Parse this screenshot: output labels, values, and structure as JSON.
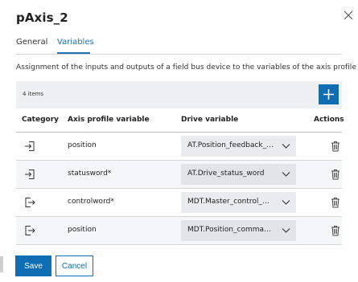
{
  "dialog": {
    "title": "pAxis_2",
    "close_icon": "close-icon"
  },
  "tabs": [
    {
      "label": "General",
      "active": false
    },
    {
      "label": "Variables",
      "active": true
    }
  ],
  "description": "Assignment of the inputs and outputs of a field bus device to the variables of the axis profile",
  "toolbar": {
    "item_count": "4 items",
    "add_icon": "plus-icon"
  },
  "table": {
    "headers": {
      "category": "Category",
      "axis_profile_variable": "Axis profile variable",
      "drive_variable": "Drive variable",
      "actions": "Actions"
    },
    "rows": [
      {
        "category_icon": "input-icon",
        "variable": "position",
        "drive_variable": "AT.Position_feedback_value",
        "action_icon": "trash-icon"
      },
      {
        "category_icon": "input-icon",
        "variable": "statusword*",
        "drive_variable": "AT.Drive_status_word",
        "action_icon": "trash-icon"
      },
      {
        "category_icon": "output-icon",
        "variable": "controlword*",
        "drive_variable": "MDT.Master_control_word",
        "action_icon": "trash-icon"
      },
      {
        "category_icon": "output-icon",
        "variable": "position",
        "drive_variable": "MDT.Position_command_value",
        "action_icon": "trash-icon"
      }
    ]
  },
  "footer": {
    "save_label": "Save",
    "cancel_label": "Cancel"
  },
  "colors": {
    "accent": "#0f6db3",
    "tab_active": "#1f73b7",
    "toolbar_bg": "#eef0f2",
    "select_bg": "#e9ebed"
  }
}
